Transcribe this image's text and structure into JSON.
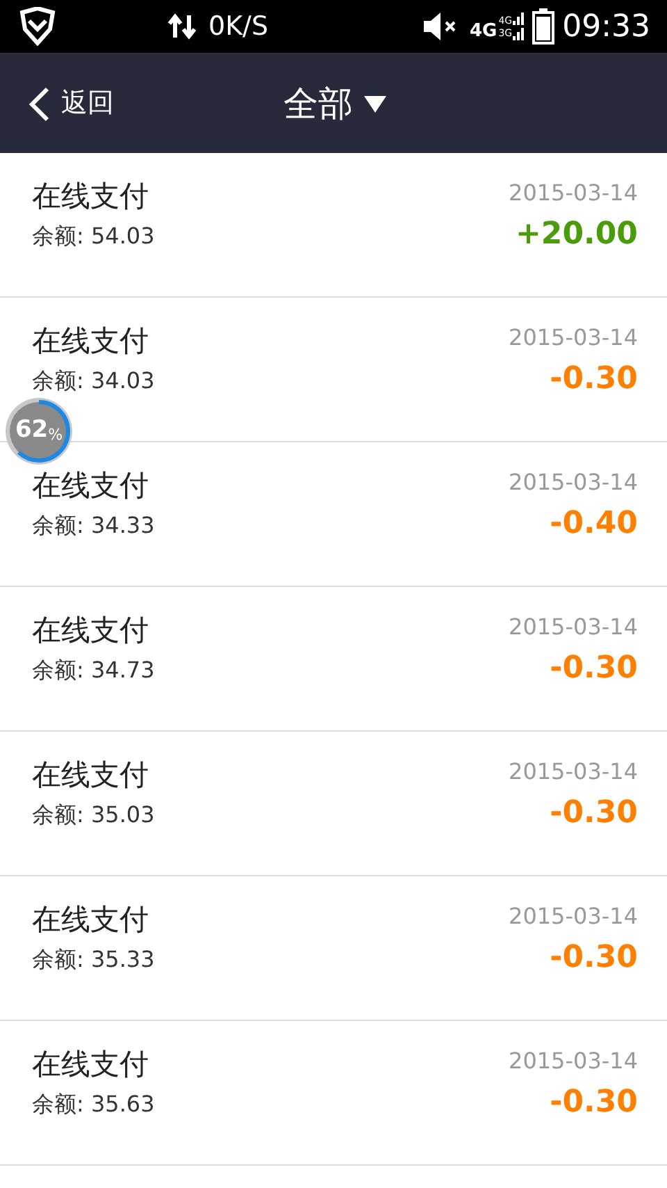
{
  "status_bar": {
    "speed": "0K/S",
    "network_large": "4G",
    "network_top": "4G",
    "network_bottom": "3G",
    "time": "09:33"
  },
  "header": {
    "back_label": "返回",
    "title": "全部"
  },
  "transactions": [
    {
      "title": "在线支付",
      "balance": "余额: 54.03",
      "date": "2015-03-14",
      "amount": "+20.00",
      "color": "#4a9c0a"
    },
    {
      "title": "在线支付",
      "balance": "余额: 34.03",
      "date": "2015-03-14",
      "amount": "-0.30",
      "color": "#ff7f00"
    },
    {
      "title": "在线支付",
      "balance": "余额: 34.33",
      "date": "2015-03-14",
      "amount": "-0.40",
      "color": "#ff7f00"
    },
    {
      "title": "在线支付",
      "balance": "余额: 34.73",
      "date": "2015-03-14",
      "amount": "-0.30",
      "color": "#ff7f00"
    },
    {
      "title": "在线支付",
      "balance": "余额: 35.03",
      "date": "2015-03-14",
      "amount": "-0.30",
      "color": "#ff7f00"
    },
    {
      "title": "在线支付",
      "balance": "余额: 35.33",
      "date": "2015-03-14",
      "amount": "-0.30",
      "color": "#ff7f00"
    },
    {
      "title": "在线支付",
      "balance": "余额: 35.63",
      "date": "2015-03-14",
      "amount": "-0.30",
      "color": "#ff7f00"
    }
  ],
  "memory_bubble": {
    "value": "62",
    "unit": "%",
    "level": 0.62
  }
}
